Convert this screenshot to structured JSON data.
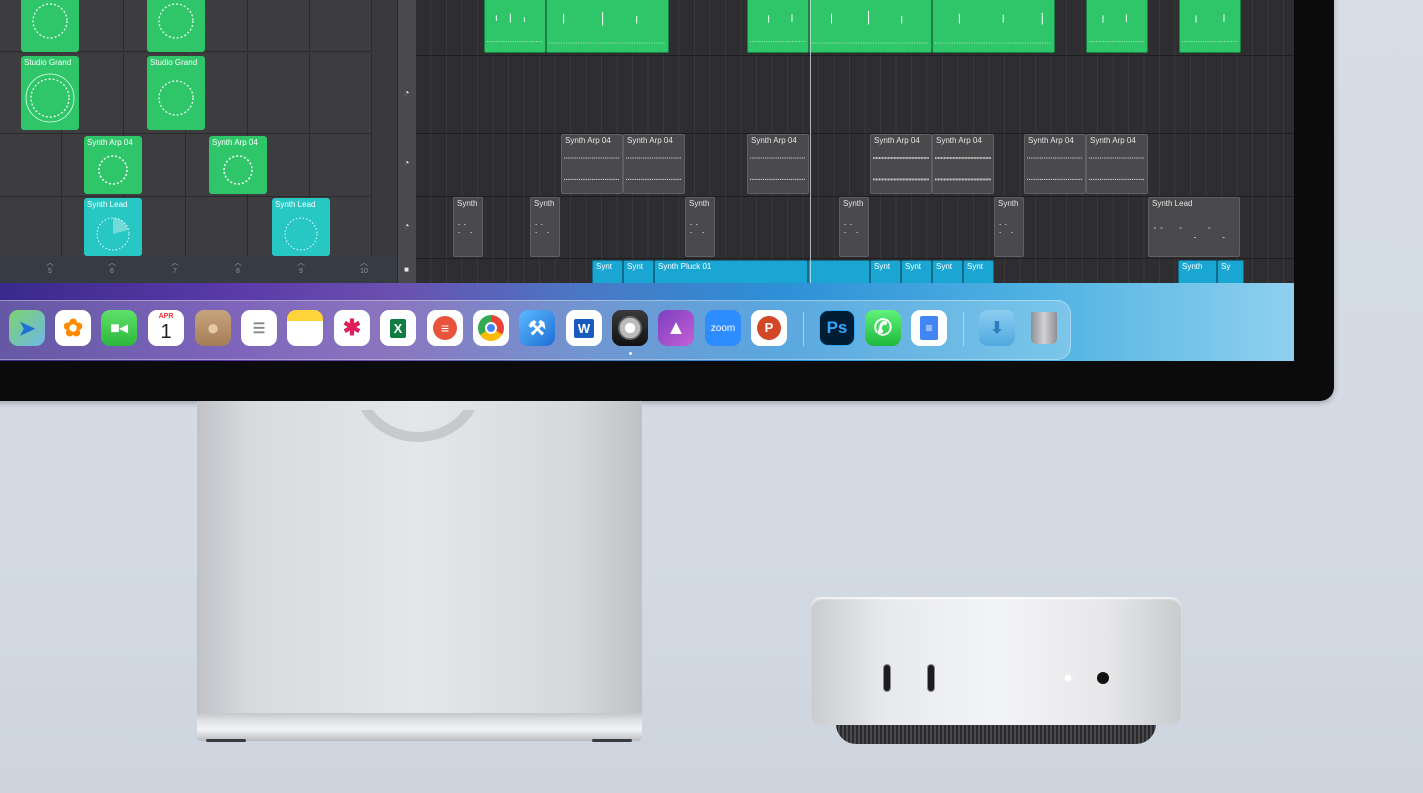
{
  "grid": {
    "cells": [
      {
        "label": "",
        "color": "green"
      },
      {
        "label": "",
        "color": "green"
      },
      {
        "label": "Studio Grand",
        "color": "green"
      },
      {
        "label": "Studio Grand",
        "color": "green"
      },
      {
        "label": "Synth Arp 04",
        "color": "green"
      },
      {
        "label": "Synth Arp 04",
        "color": "green"
      },
      {
        "label": "Synth Lead",
        "color": "teal"
      },
      {
        "label": "Synth Lead",
        "color": "teal"
      }
    ],
    "columns": [
      "5",
      "6",
      "7",
      "8",
      "9",
      "10"
    ]
  },
  "tracks": {
    "arp_regions": [
      "Synth Arp 04",
      "Synth Arp 04",
      "Synth Arp 04",
      "Synth Arp 04",
      "Synth Arp 04",
      "Synth Arp 04",
      "Synth Arp 04"
    ],
    "lead_regions": [
      "Synth",
      "Synth",
      "Synth",
      "Synth",
      "Synth",
      "Synth Lead"
    ],
    "pluck_regions": [
      "Synt",
      "Synt",
      "Synth Pluck 01",
      "Synt",
      "Synt",
      "Synt",
      "Synt",
      "Synth",
      "Sy"
    ]
  },
  "dock": {
    "apps": [
      "Maps",
      "Photos",
      "FaceTime",
      "Calendar",
      "Contacts",
      "Reminders",
      "Notes",
      "Slack",
      "Microsoft Excel",
      "Speeko",
      "Google Chrome",
      "Xcode",
      "Microsoft Word",
      "Logic Pro",
      "Affinity Photo",
      "Zoom",
      "Microsoft PowerPoint",
      "Adobe Photoshop",
      "WhatsApp",
      "Google Docs",
      "Downloads",
      "Trash"
    ],
    "calendar_month": "APR",
    "calendar_day": "1",
    "excel_glyph": "X",
    "word_glyph": "W",
    "powerpoint_glyph": "P",
    "photoshop_glyph": "Ps",
    "zoom_glyph": "zoom"
  },
  "colors": {
    "region_green": "#2fc66a",
    "region_teal": "#27c7c4",
    "region_blue": "#1aa6d3",
    "background": "#d6dde7"
  }
}
